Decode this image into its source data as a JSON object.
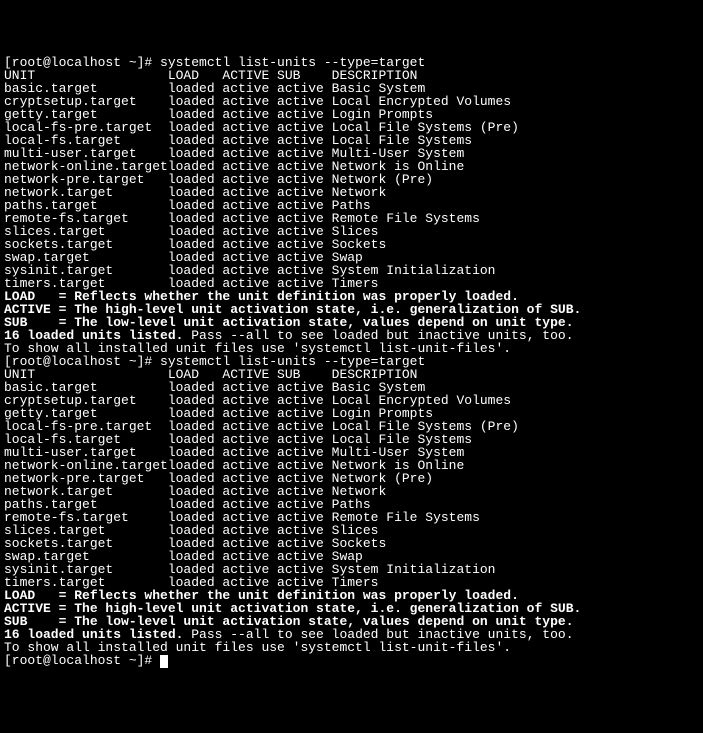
{
  "prompt1": "[root@localhost ~]# ",
  "cmd": "systemctl list-units --type=target",
  "header": {
    "unit": "UNIT",
    "load": "LOAD",
    "active": "ACTIVE",
    "sub": "SUB",
    "description": "DESCRIPTION"
  },
  "units": [
    {
      "name": "basic.target",
      "load": "loaded",
      "active": "active",
      "sub": "active",
      "desc": "Basic System"
    },
    {
      "name": "cryptsetup.target",
      "load": "loaded",
      "active": "active",
      "sub": "active",
      "desc": "Local Encrypted Volumes"
    },
    {
      "name": "getty.target",
      "load": "loaded",
      "active": "active",
      "sub": "active",
      "desc": "Login Prompts"
    },
    {
      "name": "local-fs-pre.target",
      "load": "loaded",
      "active": "active",
      "sub": "active",
      "desc": "Local File Systems (Pre)"
    },
    {
      "name": "local-fs.target",
      "load": "loaded",
      "active": "active",
      "sub": "active",
      "desc": "Local File Systems"
    },
    {
      "name": "multi-user.target",
      "load": "loaded",
      "active": "active",
      "sub": "active",
      "desc": "Multi-User System"
    },
    {
      "name": "network-online.target",
      "load": "loaded",
      "active": "active",
      "sub": "active",
      "desc": "Network is Online"
    },
    {
      "name": "network-pre.target",
      "load": "loaded",
      "active": "active",
      "sub": "active",
      "desc": "Network (Pre)"
    },
    {
      "name": "network.target",
      "load": "loaded",
      "active": "active",
      "sub": "active",
      "desc": "Network"
    },
    {
      "name": "paths.target",
      "load": "loaded",
      "active": "active",
      "sub": "active",
      "desc": "Paths"
    },
    {
      "name": "remote-fs.target",
      "load": "loaded",
      "active": "active",
      "sub": "active",
      "desc": "Remote File Systems"
    },
    {
      "name": "slices.target",
      "load": "loaded",
      "active": "active",
      "sub": "active",
      "desc": "Slices"
    },
    {
      "name": "sockets.target",
      "load": "loaded",
      "active": "active",
      "sub": "active",
      "desc": "Sockets"
    },
    {
      "name": "swap.target",
      "load": "loaded",
      "active": "active",
      "sub": "active",
      "desc": "Swap"
    },
    {
      "name": "sysinit.target",
      "load": "loaded",
      "active": "active",
      "sub": "active",
      "desc": "System Initialization"
    },
    {
      "name": "timers.target",
      "load": "loaded",
      "active": "active",
      "sub": "active",
      "desc": "Timers"
    }
  ],
  "legend": {
    "load": "LOAD   = Reflects whether the unit definition was properly loaded.",
    "active": "ACTIVE = The high-level unit activation state, i.e. generalization of SUB.",
    "sub": "SUB    = The low-level unit activation state, values depend on unit type."
  },
  "summary_bold": "16 loaded units listed.",
  "summary_rest": " Pass --all to see loaded but inactive units, too.",
  "summary_line2": "To show all installed unit files use 'systemctl list-unit-files'.",
  "prompt2": "[root@localhost ~]# ",
  "colw": {
    "unit": 21,
    "load": 7,
    "active": 7,
    "sub": 7
  }
}
